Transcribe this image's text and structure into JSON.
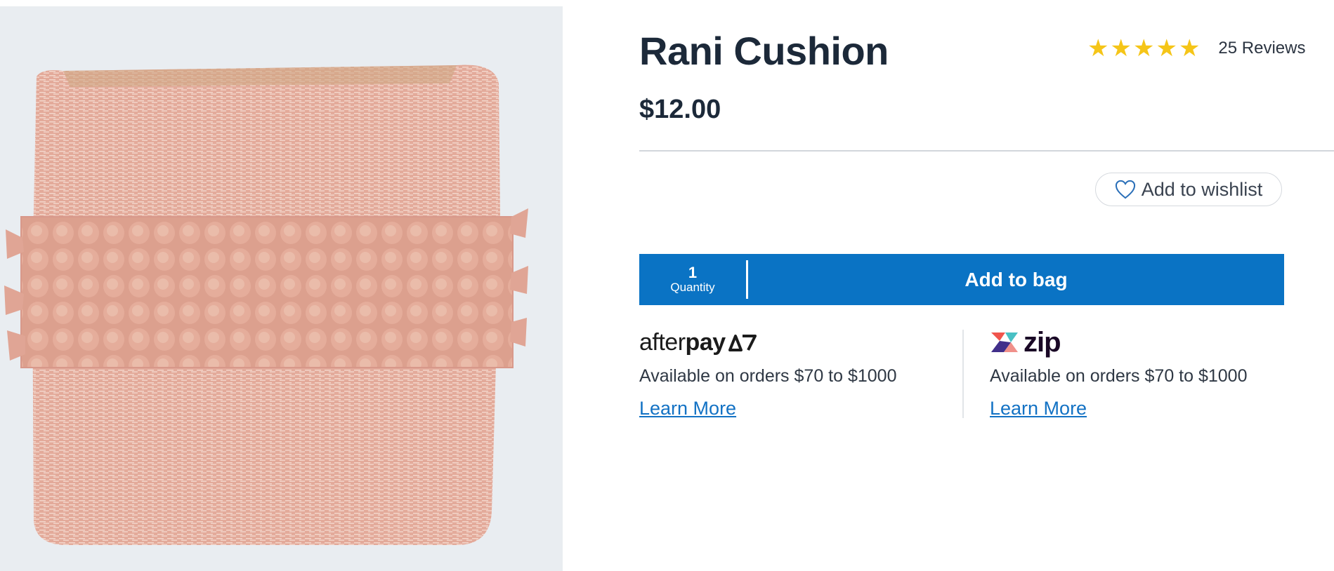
{
  "product": {
    "title": "Rani Cushion",
    "price": "$12.00",
    "rating": {
      "value": 5,
      "max": 5,
      "reviews_label": "25 Reviews"
    },
    "image_icon": "pink-woven-cushion-image"
  },
  "actions": {
    "wishlist_label": "Add to wishlist",
    "quantity_value": "1",
    "quantity_label": "Quantity",
    "add_to_bag_label": "Add to bag"
  },
  "payments": [
    {
      "brand_regular": "after",
      "brand_bold": "pay",
      "note": "Available on orders $70 to $1000",
      "link": "Learn More"
    },
    {
      "brand": "zip",
      "note": "Available on orders $70 to $1000",
      "link": "Learn More"
    }
  ],
  "colors": {
    "accent_blue": "#0a73c4",
    "star_yellow": "#f5c518",
    "heading": "#1c2939",
    "link": "#1372c4"
  }
}
